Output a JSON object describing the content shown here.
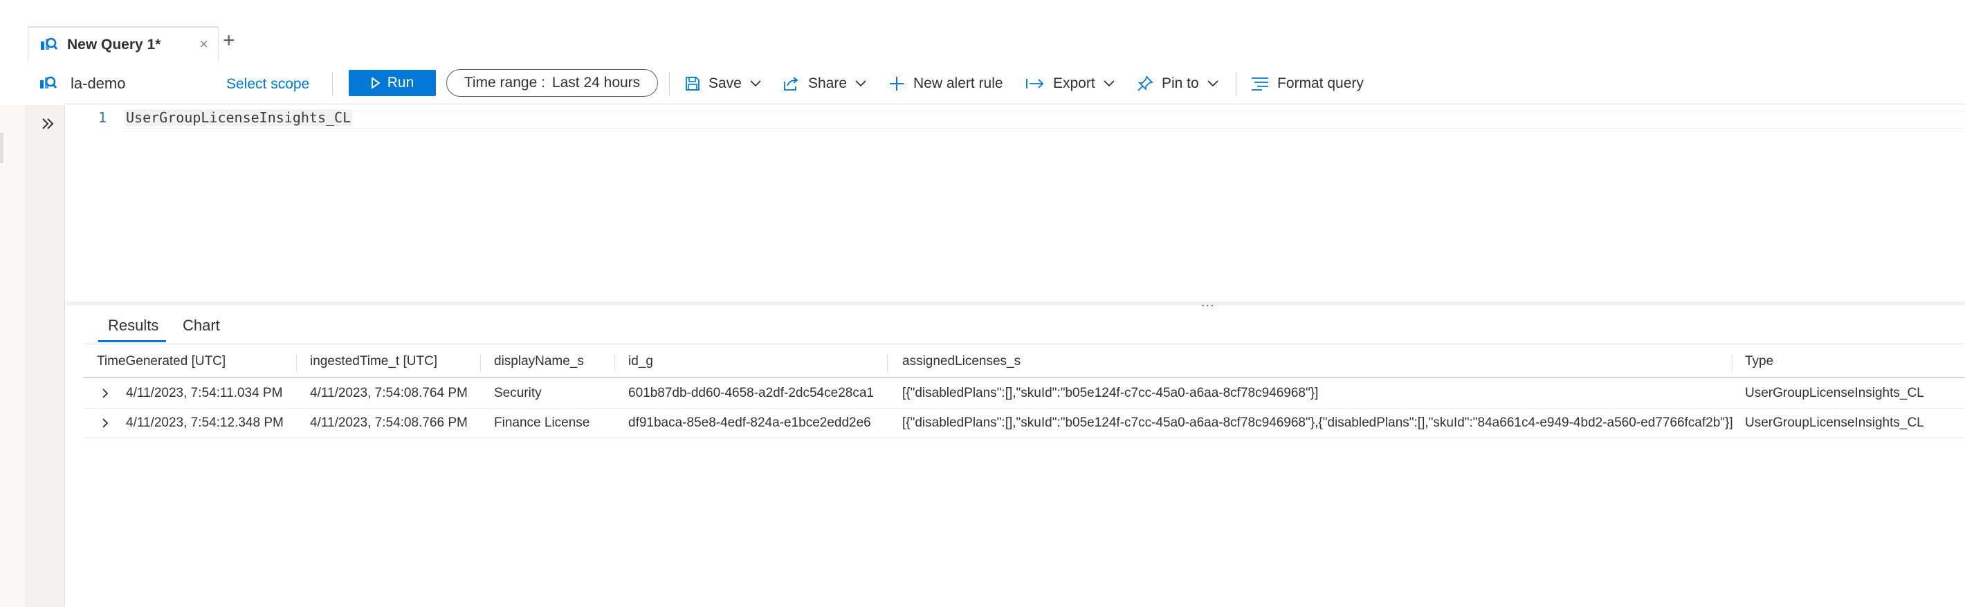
{
  "tabs": [
    {
      "label": "New Query 1*",
      "close": "×"
    }
  ],
  "add_tab": "+",
  "toolbar": {
    "workspace": "la-demo",
    "select_scope": "Select scope",
    "run": "Run",
    "time_range_key": "Time range :",
    "time_range_value": "Last 24 hours",
    "save": "Save",
    "share": "Share",
    "new_alert_rule": "New alert rule",
    "export": "Export",
    "pin_to": "Pin to",
    "format_query": "Format query"
  },
  "editor": {
    "line_number": "1",
    "code": "UserGroupLicenseInsights_CL",
    "splitter": "..."
  },
  "results": {
    "tabs": [
      "Results",
      "Chart"
    ],
    "active_tab": "Results",
    "columns": [
      "TimeGenerated [UTC]",
      "ingestedTime_t [UTC]",
      "displayName_s",
      "id_g",
      "assignedLicenses_s",
      "Type"
    ],
    "rows": [
      [
        "4/11/2023, 7:54:11.034 PM",
        "4/11/2023, 7:54:08.764 PM",
        "Security",
        "601b87db-dd60-4658-a2df-2dc54ce28ca1",
        "[{\"disabledPlans\":[],\"skuId\":\"b05e124f-c7cc-45a0-a6aa-8cf78c946968\"}]",
        "UserGroupLicenseInsights_CL"
      ],
      [
        "4/11/2023, 7:54:12.348 PM",
        "4/11/2023, 7:54:08.766 PM",
        "Finance License",
        "df91baca-85e8-4edf-824a-e1bce2edd2e6",
        "[{\"disabledPlans\":[],\"skuId\":\"b05e124f-c7cc-45a0-a6aa-8cf78c946968\"},{\"disabledPlans\":[],\"skuId\":\"84a661c4-e949-4bd2-a560-ed7766fcaf2b\"}]",
        "UserGroupLicenseInsights_CL"
      ]
    ]
  },
  "icons": {
    "query_tab": "log-analytics-icon",
    "workspace": "log-analytics-icon",
    "run": "play-icon",
    "save": "save-icon",
    "share": "share-icon",
    "new_alert_rule": "plus-icon",
    "export": "export-arrow-icon",
    "pin_to": "pin-icon",
    "format_query": "format-lines-icon",
    "rail": "double-chevron-right-icon",
    "row_expand": "chevron-right-icon"
  },
  "colors": {
    "accent": "#0078d4",
    "text": "#323130",
    "border": "#e1dfdd"
  }
}
